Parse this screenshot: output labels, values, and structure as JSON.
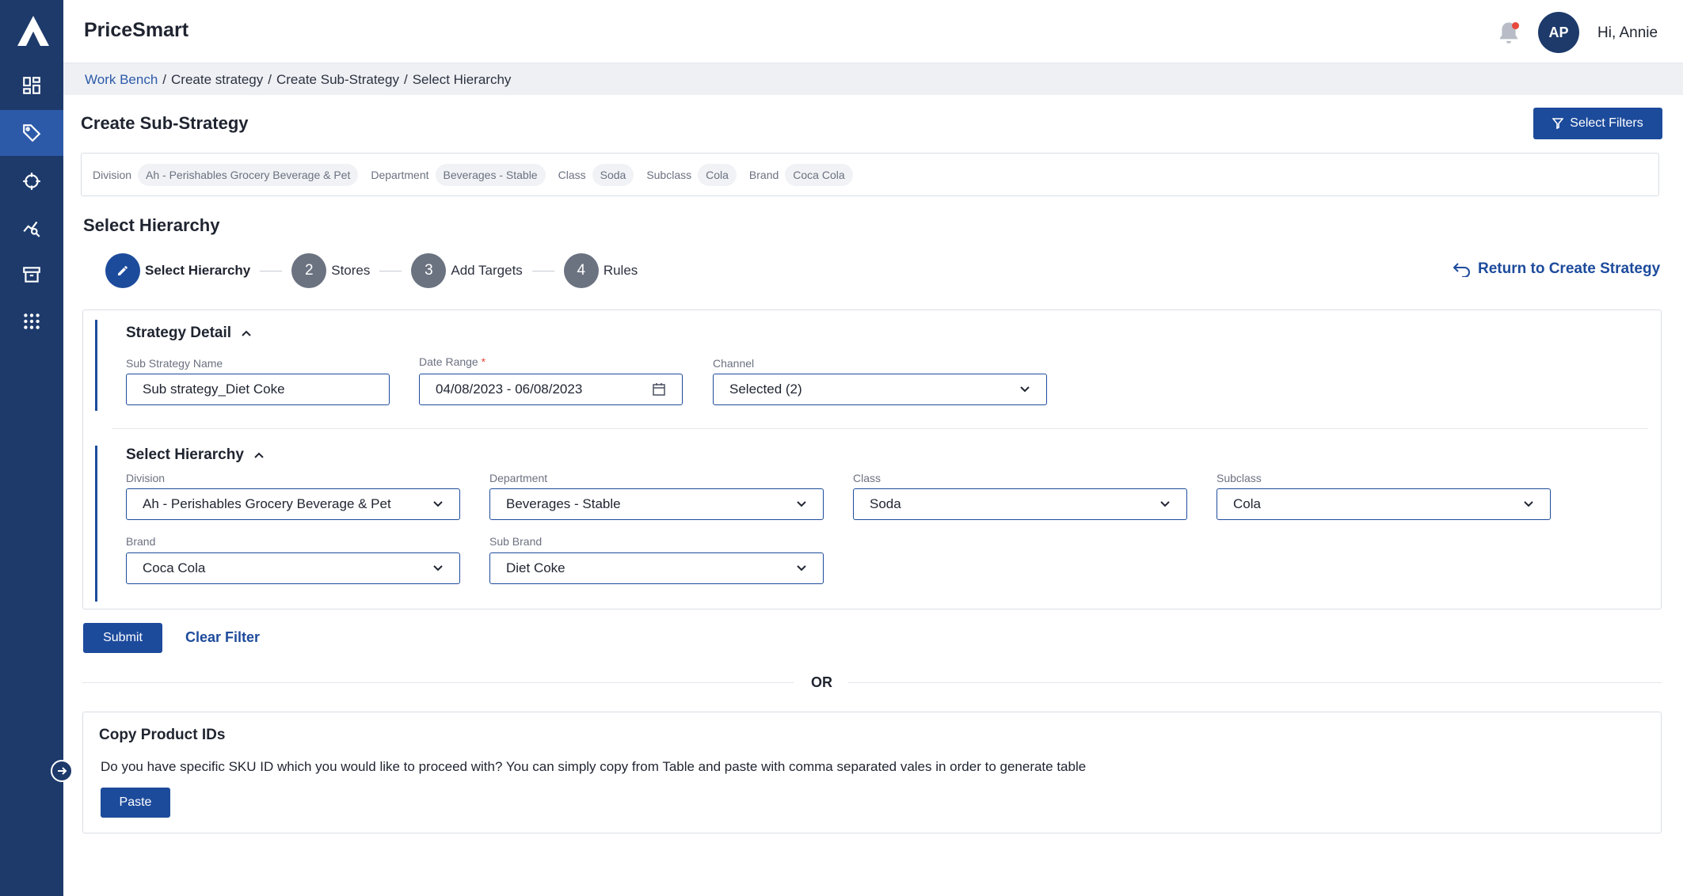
{
  "app": {
    "title": "PriceSmart",
    "greeting": "Hi, Annie",
    "avatar_initials": "AP"
  },
  "colors": {
    "sidebar": "#1d3a6b",
    "sidebar_active": "#2d5aa8",
    "primary": "#1d4b9c",
    "notification_dot": "#e8473c"
  },
  "sidebar": {
    "items": [
      {
        "icon": "dashboard-icon",
        "active": false
      },
      {
        "icon": "tag-icon",
        "active": true
      },
      {
        "icon": "crosshair-icon",
        "active": false
      },
      {
        "icon": "analytics-icon",
        "active": false
      },
      {
        "icon": "archive-icon",
        "active": false
      },
      {
        "icon": "apps-grid-icon",
        "active": false
      }
    ]
  },
  "breadcrumb": [
    "Work Bench",
    "Create strategy",
    "Create Sub-Strategy",
    "Select Hierarchy"
  ],
  "page": {
    "title": "Create Sub-Strategy",
    "select_filters_label": "Select Filters"
  },
  "filter_chips": [
    {
      "label": "Division",
      "value": "Ah - Perishables Grocery Beverage & Pet"
    },
    {
      "label": "Department",
      "value": "Beverages - Stable"
    },
    {
      "label": "Class",
      "value": "Soda"
    },
    {
      "label": "Subclass",
      "value": "Cola"
    },
    {
      "label": "Brand",
      "value": "Coca Cola"
    }
  ],
  "section_title": "Select Hierarchy",
  "stepper": {
    "steps": [
      {
        "number": "",
        "label": "Select Hierarchy",
        "active": true
      },
      {
        "number": "2",
        "label": "Stores",
        "active": false
      },
      {
        "number": "3",
        "label": "Add Targets",
        "active": false
      },
      {
        "number": "4",
        "label": "Rules",
        "active": false
      }
    ],
    "return_label": "Return to Create Strategy"
  },
  "strategy_detail": {
    "heading": "Strategy Detail",
    "sub_strategy_name": {
      "label": "Sub Strategy Name",
      "value": "Sub strategy_Diet Coke"
    },
    "date_range": {
      "label": "Date Range",
      "required_mark": "*",
      "value": "04/08/2023 - 06/08/2023"
    },
    "channel": {
      "label": "Channel",
      "value": "Selected (2)"
    }
  },
  "hierarchy": {
    "heading": "Select Hierarchy",
    "division": {
      "label": "Division",
      "value": "Ah - Perishables Grocery Beverage & Pet"
    },
    "department": {
      "label": "Department",
      "value": "Beverages - Stable"
    },
    "class": {
      "label": "Class",
      "value": "Soda"
    },
    "subclass": {
      "label": "Subclass",
      "value": "Cola"
    },
    "brand": {
      "label": "Brand",
      "value": "Coca Cola"
    },
    "sub_brand": {
      "label": "Sub Brand",
      "value": "Diet Coke"
    }
  },
  "actions": {
    "submit": "Submit",
    "clear": "Clear Filter",
    "or": "OR"
  },
  "copy_ids": {
    "title": "Copy Product IDs",
    "description": "Do you have specific SKU ID which you would like to proceed with? You can simply copy from Table and paste with comma separated vales in order to generate table",
    "paste_label": "Paste"
  }
}
